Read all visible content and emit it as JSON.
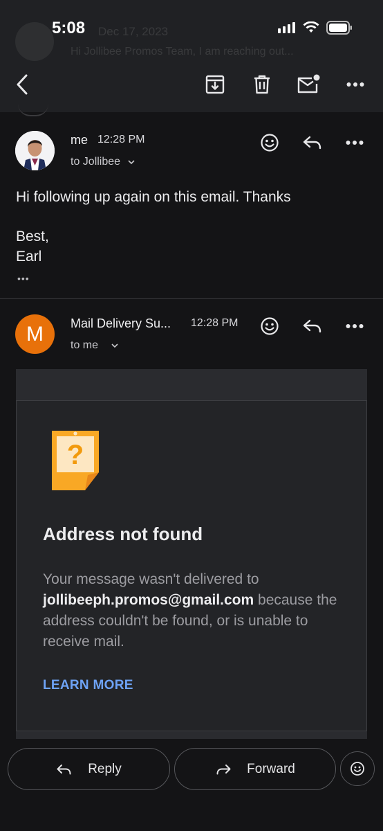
{
  "status_bar": {
    "time": "5:08"
  },
  "background_preview": {
    "date": "Dec 17, 2023",
    "snippet": "Hi Jollibee Promos Team, I am reaching out..."
  },
  "toolbar": {
    "back_icon": "chevron-left-icon",
    "archive_icon": "archive-icon",
    "delete_icon": "trash-icon",
    "unread_icon": "mark-unread-icon",
    "more_icon": "more-horizontal-icon"
  },
  "messages": [
    {
      "sender": "me",
      "time": "12:28 PM",
      "to": "to Jollibee",
      "body": [
        "Hi following up again on this email. Thanks",
        "",
        "Best,",
        "Earl"
      ],
      "trimmed_indicator": "•••"
    },
    {
      "sender": "Mail Delivery Su...",
      "avatar_letter": "M",
      "avatar_color": "#e8710a",
      "time": "12:28 PM",
      "to": "to me"
    }
  ],
  "bounce_card": {
    "title": "Address not found",
    "message_prefix": "Your message wasn't delivered to ",
    "address": "jollibeeph.promos@gmail.com",
    "message_suffix": " because the address couldn't be found, or is unable to receive mail.",
    "link": "LEARN MORE",
    "icon_color": "#f9a825"
  },
  "actions": {
    "reply": "Reply",
    "forward": "Forward"
  },
  "colors": {
    "background": "#141416",
    "toolbar": "#202124",
    "link": "#6ea3f6"
  }
}
